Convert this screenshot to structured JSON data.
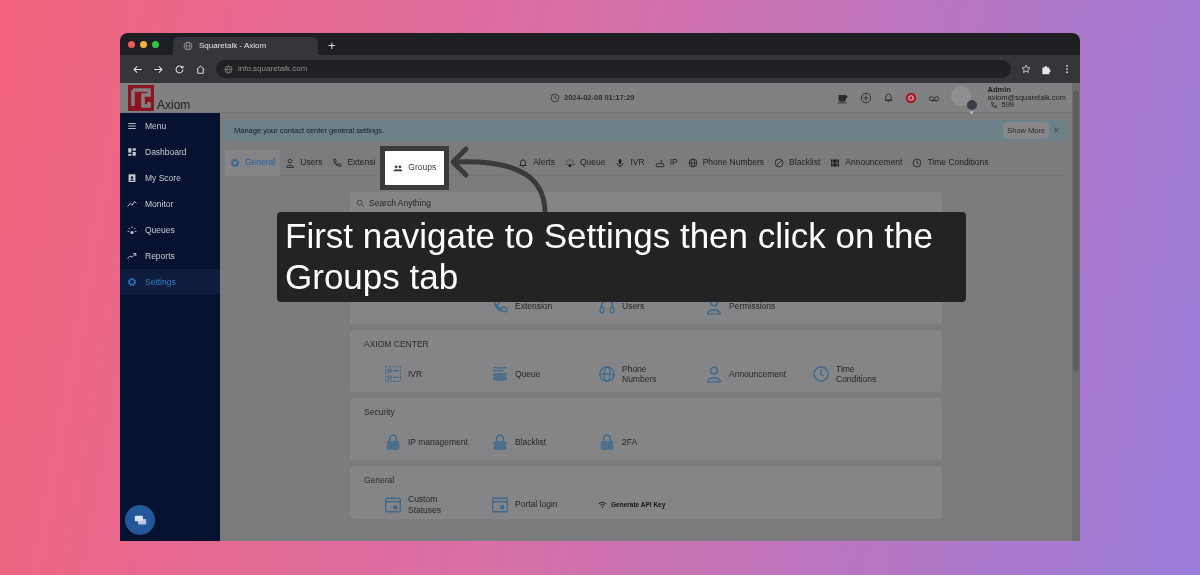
{
  "browser": {
    "tab_title": "Squaretalk - Axiom",
    "new_tab": "+",
    "url": "info.squaretalk.com"
  },
  "header": {
    "logo": "Axiom",
    "datetime": "2024-02-08 01:17:29",
    "user": {
      "name": "Admin",
      "email": "axiom@squaretalk.com",
      "extension": "599"
    }
  },
  "sidebar": {
    "menu_label": "Menu",
    "items": [
      {
        "label": "Dashboard",
        "selected": false
      },
      {
        "label": "My Score",
        "selected": false
      },
      {
        "label": "Monitor",
        "selected": false
      },
      {
        "label": "Queues",
        "selected": false
      },
      {
        "label": "Reports",
        "selected": false
      },
      {
        "label": "Settings",
        "selected": true
      }
    ]
  },
  "banner": {
    "text": "Manage your contact center general settings.",
    "button": "Show More",
    "close": "×"
  },
  "tabs": [
    {
      "label": "General",
      "selected": true,
      "highlighted": false
    },
    {
      "label": "Users",
      "selected": false,
      "highlighted": false
    },
    {
      "label": "Extensi",
      "selected": false,
      "highlighted": false
    },
    {
      "label": "Groups",
      "selected": false,
      "highlighted": true
    },
    {
      "label": "Alerts",
      "selected": false,
      "highlighted": false
    },
    {
      "label": "Queue",
      "selected": false,
      "highlighted": false
    },
    {
      "label": "IVR",
      "selected": false,
      "highlighted": false
    },
    {
      "label": "IP",
      "selected": false,
      "highlighted": false
    },
    {
      "label": "Phone Numbers",
      "selected": false,
      "highlighted": false
    },
    {
      "label": "Blacklist",
      "selected": false,
      "highlighted": false
    },
    {
      "label": "Announcement",
      "selected": false,
      "highlighted": false
    },
    {
      "label": "Time Conditions",
      "selected": false,
      "highlighted": false
    }
  ],
  "search": {
    "placeholder": "Search Anything"
  },
  "sections": [
    {
      "items": [
        {
          "label": "Extension",
          "kind": "tile"
        },
        {
          "label": "Users",
          "kind": "tile"
        },
        {
          "label": "Permissions",
          "kind": "tile"
        }
      ]
    },
    {
      "title": "AXIOM CENTER",
      "items": [
        {
          "label": "IVR",
          "kind": "tile"
        },
        {
          "label": "Queue",
          "kind": "tile"
        },
        {
          "label": "Phone Numbers",
          "kind": "tile"
        },
        {
          "label": "Announcement",
          "kind": "tile"
        },
        {
          "label": "Time Conditions",
          "kind": "tile"
        }
      ]
    },
    {
      "title": "Security",
      "items": [
        {
          "label": "IP management",
          "kind": "tile"
        },
        {
          "label": "Blacklist",
          "kind": "tile"
        },
        {
          "label": "2FA",
          "kind": "tile"
        }
      ]
    },
    {
      "title": "General",
      "items": [
        {
          "label": "Custom Statuses",
          "kind": "tile"
        },
        {
          "label": "Portal login",
          "kind": "tile"
        },
        {
          "label": "Generate API Key",
          "kind": "action"
        }
      ]
    }
  ],
  "callout": {
    "caption": "First navigate to Settings then click on the Groups tab"
  }
}
